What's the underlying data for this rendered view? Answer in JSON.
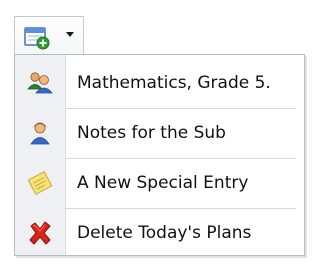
{
  "toolbar": {
    "new_entry_button": {
      "icon": "calendar-add-icon",
      "dropdown_icon": "chevron-down-icon"
    }
  },
  "menu": {
    "items": [
      {
        "label": "Mathematics, Grade 5.",
        "icon": "group-icon"
      },
      {
        "label": "Notes for the Sub",
        "icon": "user-icon"
      },
      {
        "label": "A New Special Entry",
        "icon": "sticky-note-icon"
      },
      {
        "label": "Delete Today's Plans",
        "icon": "delete-x-icon"
      }
    ]
  },
  "colors": {
    "menu_icon_strip": "#eef0f3",
    "separator": "#d6d9dd",
    "delete_red": "#d92418",
    "user_blue": "#3a66c4",
    "note_yellow": "#f7e27a",
    "add_green": "#2aa12a"
  }
}
